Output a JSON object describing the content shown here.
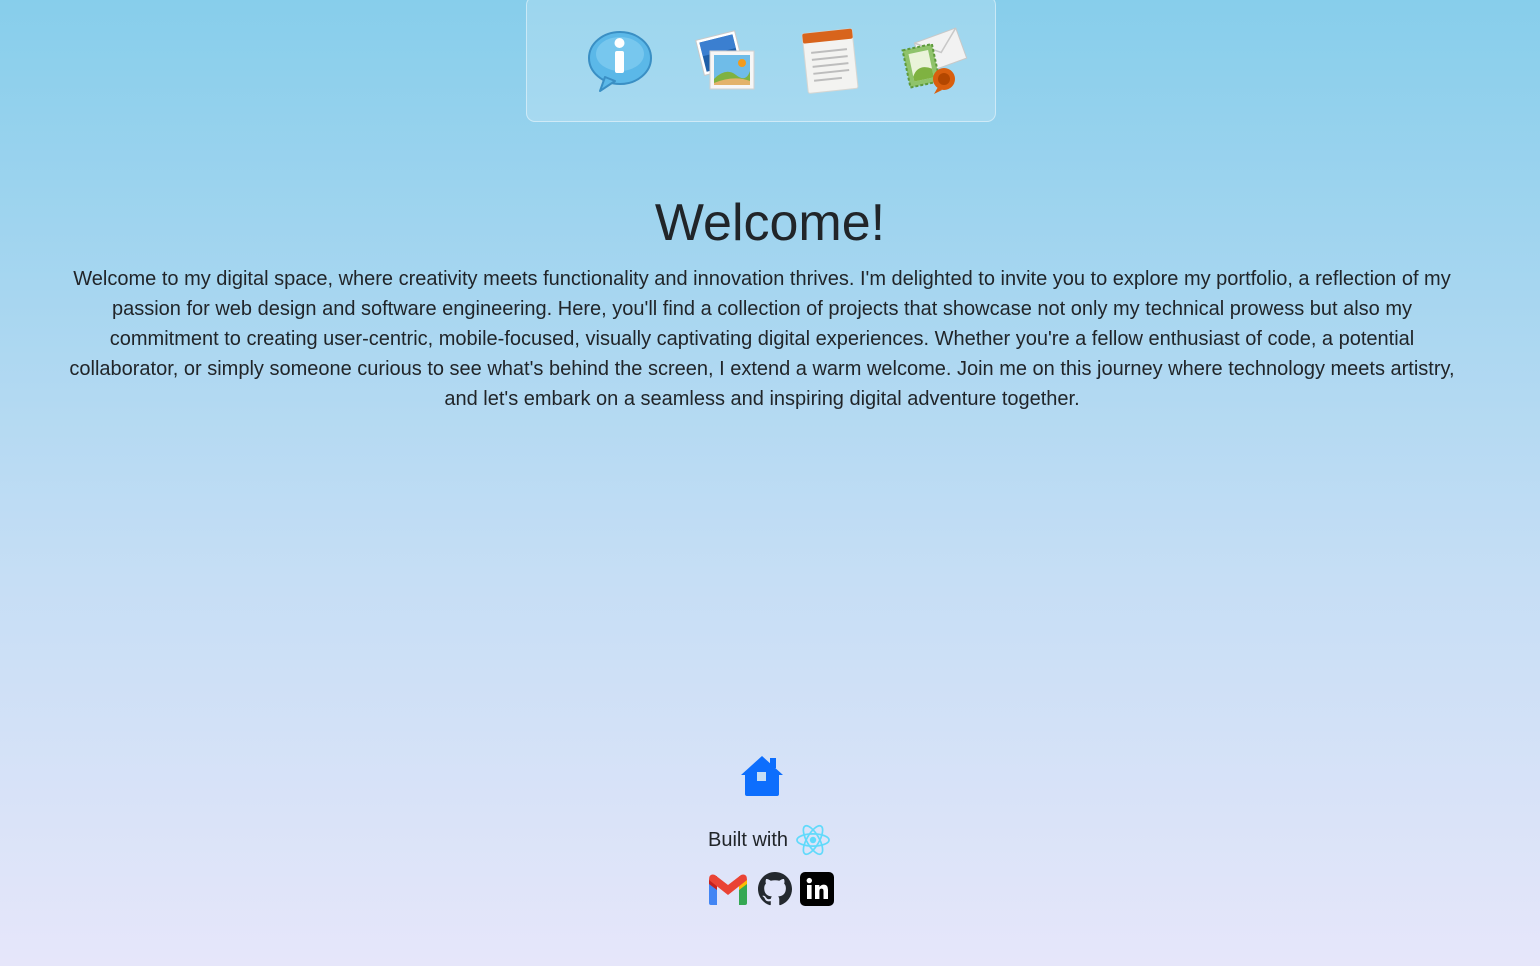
{
  "dock": {
    "items": [
      {
        "name": "about",
        "icon": "info-bubble-icon"
      },
      {
        "name": "gallery",
        "icon": "photos-icon"
      },
      {
        "name": "resume",
        "icon": "notepad-icon"
      },
      {
        "name": "contact",
        "icon": "mail-stamp-icon"
      }
    ]
  },
  "main": {
    "title": "Welcome!",
    "body": "Welcome to my digital space, where creativity meets functionality and innovation thrives. I'm delighted to invite you to explore my portfolio, a reflection of my passion for web design and software engineering. Here, you'll find a collection of projects that showcase not only my technical prowess but also my commitment to creating user-centric, mobile-focused, visually captivating digital experiences. Whether you're a fellow enthusiast of code, a potential collaborator, or simply someone curious to see what's behind the screen, I extend a warm welcome. Join me on this journey where technology meets artistry, and let's embark on a seamless and inspiring digital adventure together."
  },
  "footer": {
    "home_icon": "house-icon",
    "built_with_label": "Built with",
    "built_with_icon": "react-icon",
    "socials": [
      {
        "name": "gmail",
        "icon": "gmail-icon"
      },
      {
        "name": "github",
        "icon": "github-icon"
      },
      {
        "name": "linkedin",
        "icon": "linkedin-icon"
      }
    ]
  },
  "colors": {
    "background_top": "#87ceeb",
    "background_bottom": "#e6e6fa",
    "text": "#212529",
    "home_icon": "#0d6efd",
    "react": "#61dafb"
  }
}
